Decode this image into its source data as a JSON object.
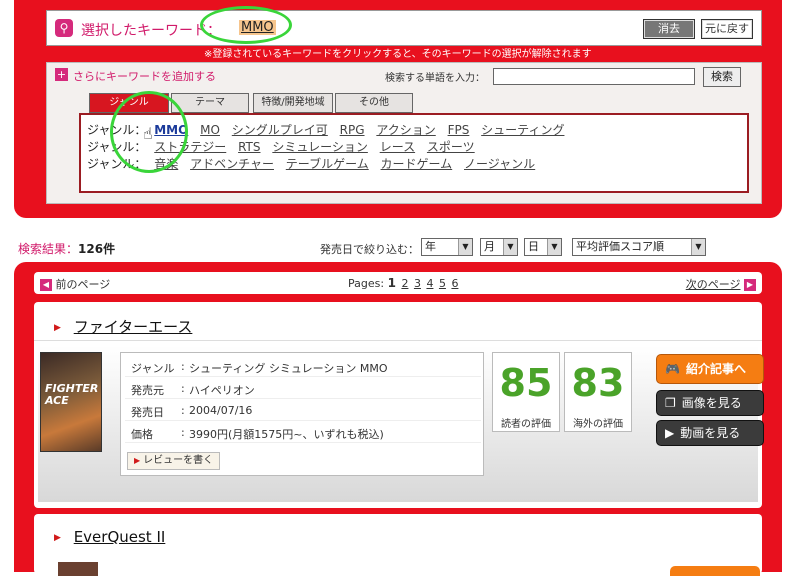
{
  "keyword_panel": {
    "title": "選択したキーワード：",
    "selected_keyword": "MMO",
    "clear_label": "消去",
    "undo_label": "元に戻す",
    "note": "※登録されているキーワードをクリックすると、そのキーワードの選択が解除されます"
  },
  "add_keyword": {
    "title": "さらにキーワードを追加する",
    "search_label": "検索する単語を入力：",
    "search_value": "",
    "search_button": "検索",
    "tabs": [
      "ジャンル",
      "テーマ",
      "特徴/開発地域",
      "その他"
    ],
    "genre_label": "ジャンル：",
    "genre_rows": [
      [
        "MMO",
        "MO",
        "シングルプレイ可",
        "RPG",
        "アクション",
        "FPS",
        "シューティング"
      ],
      [
        "ストラテジー",
        "RTS",
        "シミュレーション",
        "レース",
        "スポーツ"
      ],
      [
        "音楽",
        "アドベンチャー",
        "テーブルゲーム",
        "カードゲーム",
        "ノージャンル"
      ]
    ]
  },
  "results": {
    "label": "検索結果：",
    "count": "126件",
    "filter_label": "発売日で絞り込む：",
    "year": "年",
    "month": "月",
    "day": "日",
    "sort": "平均評価スコア順"
  },
  "pager": {
    "prev": "前のページ",
    "pages_label": "Pages:",
    "current": "1",
    "pages": [
      "2",
      "3",
      "4",
      "5",
      "6"
    ],
    "next": "次のページ"
  },
  "items": [
    {
      "title": "ファイターエース",
      "cover_text": "FIGHTER ACE",
      "fields": [
        {
          "k": "ジャンル",
          "v": "シューティング シミュレーション MMO"
        },
        {
          "k": "発売元",
          "v": "ハイペリオン"
        },
        {
          "k": "発売日",
          "v": "2004/07/16"
        },
        {
          "k": "価格",
          "v": "3990円(月額1575円~、いずれも税込)"
        }
      ],
      "review_button": "レビューを書く",
      "reader_score": "85",
      "reader_caption": "読者の評価",
      "overseas_score": "83",
      "overseas_caption": "海外の評価",
      "article_button": "紹介記事へ",
      "images_button": "画像を見る",
      "video_button": "動画を見る"
    },
    {
      "title": "EverQuest II"
    }
  ],
  "colors": {
    "panel_red": "#e8101e",
    "accent_pink": "#d11a6a",
    "score_green": "#4aa329",
    "article_orange": "#f57d12",
    "annotation_green": "#3ad53a"
  }
}
